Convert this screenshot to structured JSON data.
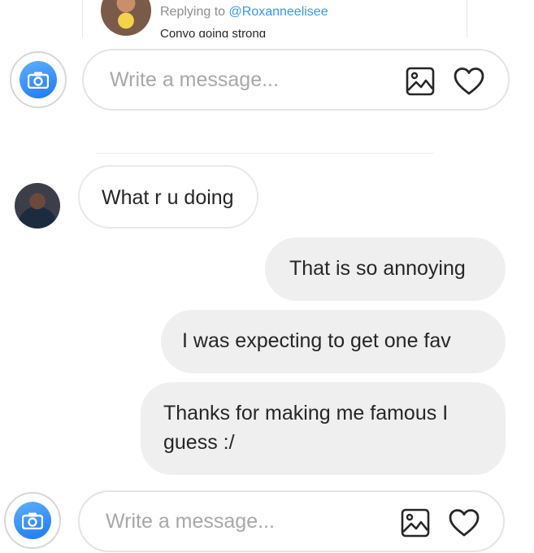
{
  "reply": {
    "prefix": "Replying to ",
    "handle": "@Roxanneelisee",
    "preview": "Convo going strong"
  },
  "composer": {
    "placeholder": "Write a message..."
  },
  "messages": [
    {
      "direction": "in",
      "text": "What r u doing"
    },
    {
      "direction": "out",
      "text": "That is so annoying"
    },
    {
      "direction": "out",
      "text": "I was expecting to get one fav"
    },
    {
      "direction": "out",
      "line1": "Thanks for making me famous I",
      "line2": "guess :/"
    }
  ],
  "colors": {
    "accent": "#3897f0",
    "outgoing_bubble": "#efefef",
    "placeholder": "#a8a8a8"
  },
  "icons": [
    "camera-icon",
    "image-icon",
    "heart-icon"
  ]
}
